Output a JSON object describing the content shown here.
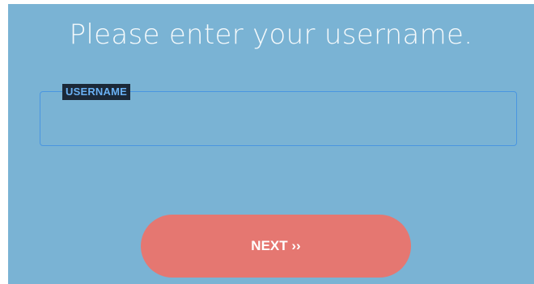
{
  "heading": "Please enter your username.",
  "username_field": {
    "label": "USERNAME",
    "value": "",
    "placeholder": ""
  },
  "next_button": {
    "label": "NEXT ››"
  },
  "colors": {
    "background": "#7ab3d4",
    "field_border": "#4a96e0",
    "label_background": "#1b2838",
    "label_text": "#6ab0f3",
    "button": "#e57771",
    "text": "#ffffff"
  }
}
